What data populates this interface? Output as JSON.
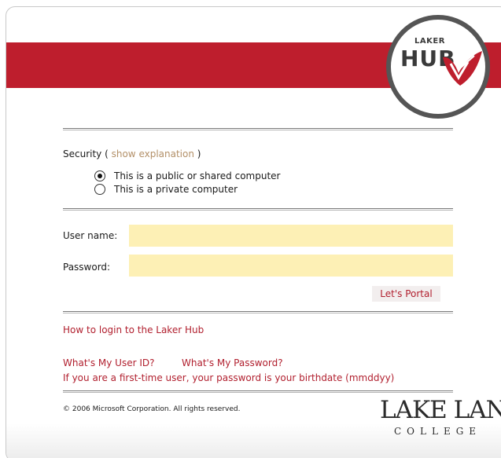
{
  "header": {
    "logo_small": "LAKER",
    "logo_big": "HUB",
    "brand_color": "#be1e2d"
  },
  "security": {
    "label": "Security (",
    "link": "show explanation",
    "close": ")",
    "options": [
      {
        "label": "This is a public or shared computer",
        "selected": true
      },
      {
        "label": "This is a private computer",
        "selected": false
      }
    ]
  },
  "form": {
    "username_label": "User name:",
    "username_value": "",
    "password_label": "Password:",
    "password_value": "",
    "submit_label": "Let's Portal"
  },
  "links": {
    "how_to_login": "How to login to the Laker Hub",
    "user_id": "What's My User ID?",
    "password": "What's My Password?",
    "first_time_note": "If you are a first-time user, your password is your birthdate (mmddyy)"
  },
  "footer": {
    "copyright": "© 2006 Microsoft Corporation. All rights reserved.",
    "college_name": "LAKE LAND",
    "college_sub": "COLLEGE"
  }
}
